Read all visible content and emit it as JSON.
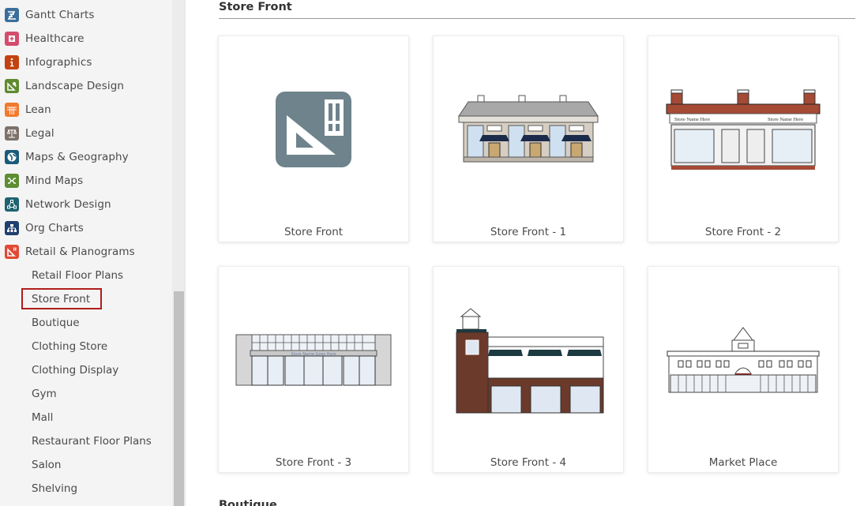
{
  "sidebar": {
    "categories": [
      {
        "label": "Gantt Charts",
        "icon": "gantt-icon",
        "color": "#3b6e99"
      },
      {
        "label": "Healthcare",
        "icon": "healthcare-cross-icon",
        "color": "#d44d6e"
      },
      {
        "label": "Infographics",
        "icon": "info-icon",
        "color": "#c4420f"
      },
      {
        "label": "Landscape Design",
        "icon": "landscape-icon",
        "color": "#5f8a2f"
      },
      {
        "label": "Lean",
        "icon": "lean-grid-icon",
        "color": "#f07a2e"
      },
      {
        "label": "Legal",
        "icon": "scales-icon",
        "color": "#7d726a"
      },
      {
        "label": "Maps & Geography",
        "icon": "globe-icon",
        "color": "#1a5b7a"
      },
      {
        "label": "Mind Maps",
        "icon": "mind-map-icon",
        "color": "#5e8d32"
      },
      {
        "label": "Network Design",
        "icon": "network-icon",
        "color": "#1e6370"
      },
      {
        "label": "Org Charts",
        "icon": "org-chart-icon",
        "color": "#1f3f6e"
      },
      {
        "label": "Retail & Planograms",
        "icon": "retail-icon",
        "color": "#e04a35"
      }
    ],
    "subitems": [
      {
        "label": "Retail Floor Plans"
      },
      {
        "label": "Store Front",
        "active": true
      },
      {
        "label": "Boutique"
      },
      {
        "label": "Clothing Store"
      },
      {
        "label": "Clothing Display"
      },
      {
        "label": "Gym"
      },
      {
        "label": "Mall"
      },
      {
        "label": "Restaurant Floor Plans"
      },
      {
        "label": "Salon"
      },
      {
        "label": "Shelving"
      }
    ],
    "active_color": "#b01c1c"
  },
  "main": {
    "section_title": "Store Front",
    "next_section_title": "Boutique",
    "templates": [
      {
        "label": "Store Front",
        "thumb": "blank-retail-template-icon"
      },
      {
        "label": "Store Front - 1",
        "thumb": "awning-storefront-thumbnail"
      },
      {
        "label": "Store Front - 2",
        "thumb": "brick-storefront-thumbnail",
        "sign_text": "Store Name Here"
      },
      {
        "label": "Store Front - 3",
        "thumb": "modern-storefront-thumbnail",
        "sign_text": "Store Name Goes Here"
      },
      {
        "label": "Store Front - 4",
        "thumb": "tower-storefront-thumbnail"
      },
      {
        "label": "Market Place",
        "thumb": "market-place-thumbnail"
      }
    ]
  }
}
